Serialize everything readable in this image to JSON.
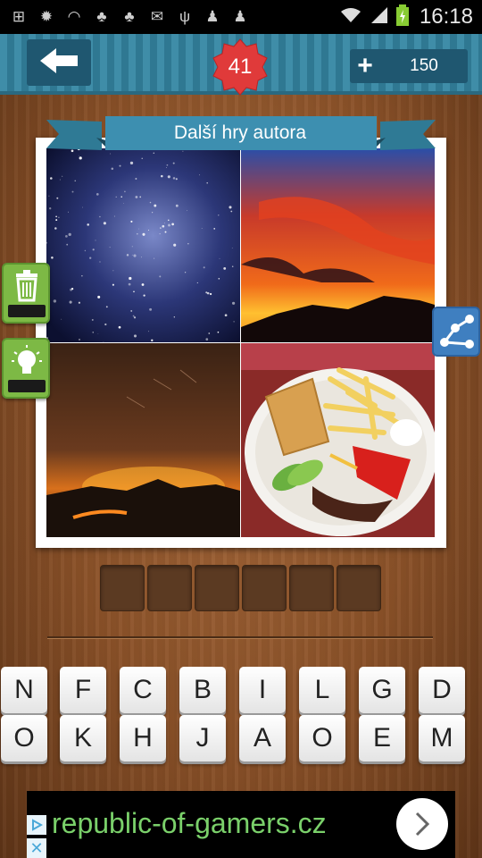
{
  "status_bar": {
    "time": "16:18",
    "icons": [
      "add-icon",
      "brightness-icon",
      "wifi-icon",
      "octopus-icon",
      "octopus-icon",
      "mail-icon",
      "usb-icon",
      "pawn-icon",
      "pawn-icon"
    ]
  },
  "header": {
    "level": "41",
    "coins_plus": "+",
    "coins": "150"
  },
  "ribbon": {
    "title": "Další hry autora"
  },
  "pictures": [
    "starry-night-sky",
    "red-sunset-clouds",
    "glowing-volcano-night",
    "plate-fries-salad"
  ],
  "answer": {
    "slots": [
      "",
      "",
      "",
      "",
      "",
      ""
    ]
  },
  "keyboard": {
    "row1": [
      "N",
      "F",
      "C",
      "B",
      "I",
      "L",
      "G",
      "D"
    ],
    "row2": [
      "O",
      "K",
      "H",
      "J",
      "A",
      "O",
      "E",
      "M"
    ]
  },
  "ad": {
    "text": "republic-of-gamers.cz"
  },
  "colors": {
    "header": "#3f8da8",
    "badge": "#e03a3a",
    "hint_button": "#7db945",
    "share_button": "#3f7fc0",
    "ad_text": "#7ad06a"
  }
}
